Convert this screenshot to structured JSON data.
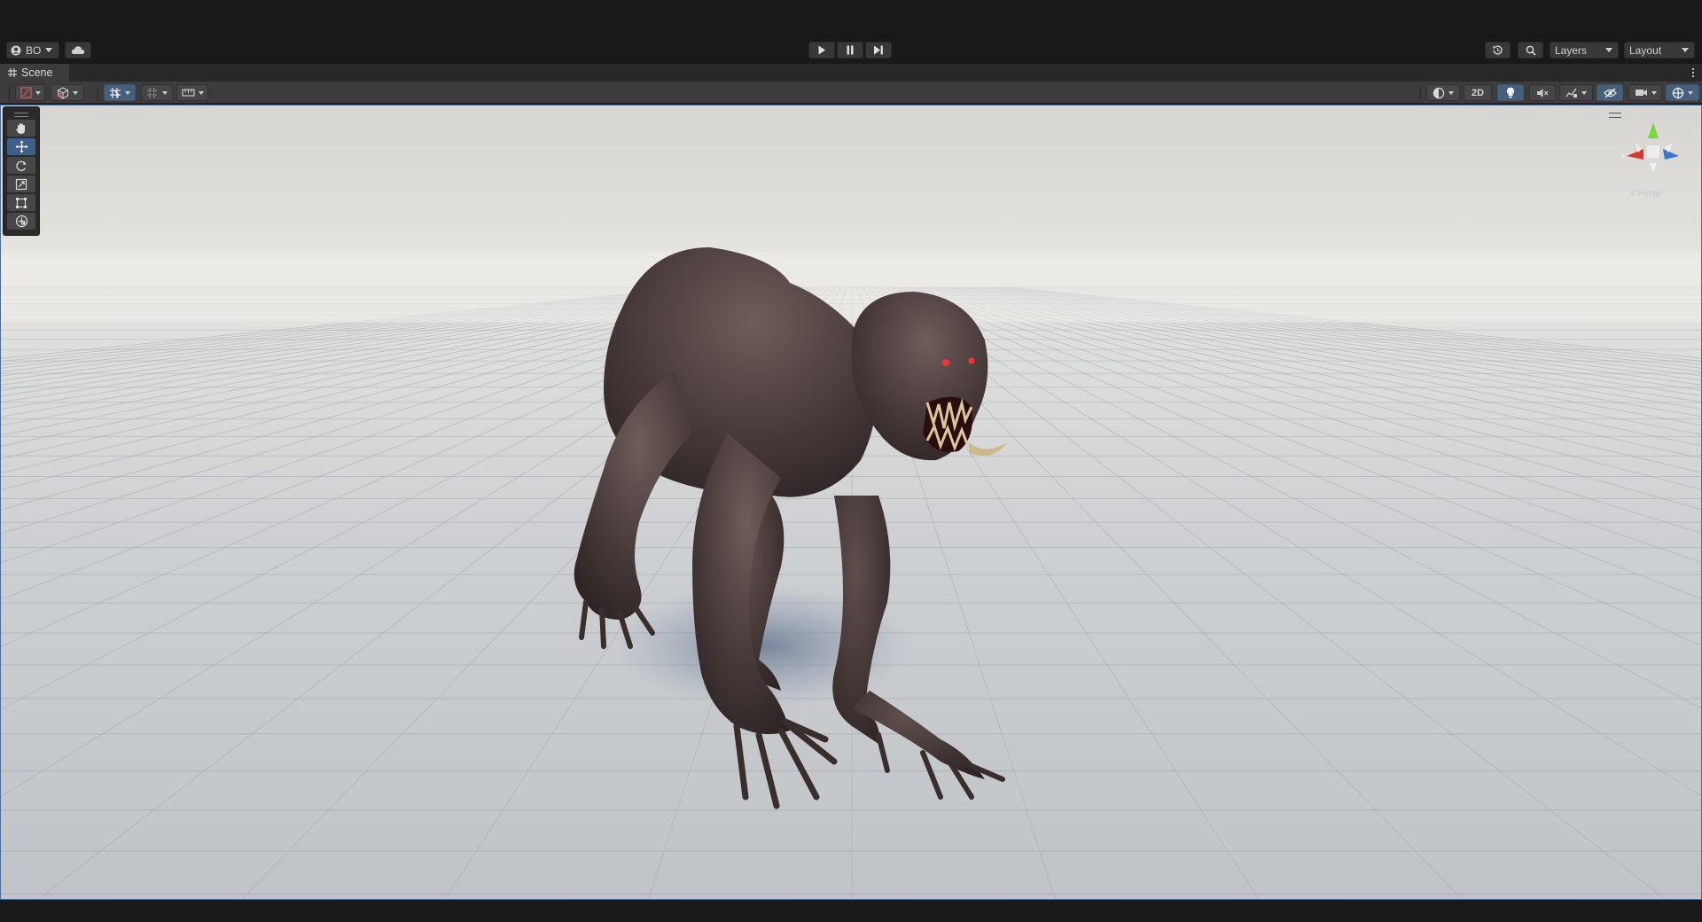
{
  "toolbar": {
    "account_label": "BO",
    "layers_label": "Layers",
    "layout_label": "Layout"
  },
  "icons": {
    "account": "account-icon",
    "cloud": "cloud-icon",
    "play": "play-icon",
    "pause": "pause-icon",
    "step": "step-icon",
    "history": "history-icon",
    "search": "search-icon"
  },
  "scene_tab": {
    "title": "Scene"
  },
  "scene_toolbar": {
    "toggle_2d_label": "2D"
  },
  "tools": [
    "hand",
    "move",
    "rotate",
    "scale",
    "rect",
    "transform"
  ],
  "active_tool": "move",
  "gizmo": {
    "projection_label": "< Persp"
  },
  "colors": {
    "accent": "#3e5f8a",
    "gizmo_x": "#d23a2a",
    "gizmo_y": "#7ed23c",
    "gizmo_z": "#3c73d2",
    "panel": "#3c3c3c",
    "background": "#191919"
  }
}
